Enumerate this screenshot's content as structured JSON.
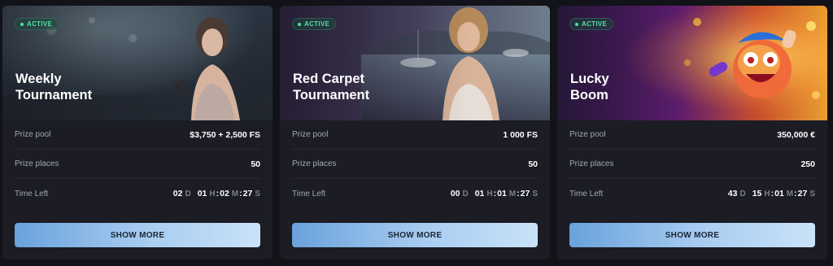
{
  "cards": [
    {
      "status": "ACTIVE",
      "title": "Weekly\nTournament",
      "prize_pool_label": "Prize pool",
      "prize_pool_value": "$3,750 + 2,500 FS",
      "prize_places_label": "Prize places",
      "prize_places_value": "50",
      "time_left_label": "Time Left",
      "time": {
        "d": "02",
        "d_unit": "D",
        "h": "01",
        "h_unit": "H",
        "m": "02",
        "m_unit": "M",
        "s": "27",
        "s_unit": "S"
      },
      "button_label": "SHOW MORE"
    },
    {
      "status": "ACTIVE",
      "title": "Red Carpet\nTournament",
      "prize_pool_label": "Prize pool",
      "prize_pool_value": "1 000 FS",
      "prize_places_label": "Prize places",
      "prize_places_value": "50",
      "time_left_label": "Time Left",
      "time": {
        "d": "00",
        "d_unit": "D",
        "h": "01",
        "h_unit": "H",
        "m": "01",
        "m_unit": "M",
        "s": "27",
        "s_unit": "S"
      },
      "button_label": "SHOW MORE"
    },
    {
      "status": "ACTIVE",
      "title": "Lucky\nBoom",
      "prize_pool_label": "Prize pool",
      "prize_pool_value": "350,000 €",
      "prize_places_label": "Prize places",
      "prize_places_value": "250",
      "time_left_label": "Time Left",
      "time": {
        "d": "43",
        "d_unit": "D",
        "h": "15",
        "h_unit": "H",
        "m": "01",
        "m_unit": "M",
        "s": "27",
        "s_unit": "S"
      },
      "button_label": "SHOW MORE"
    }
  ],
  "colors": {
    "background": "#121318",
    "card": "#1b1c24",
    "active_badge": "#4fe0a0",
    "button_gradient_start": "#6aa2dc",
    "button_gradient_end": "#c9e2f8"
  }
}
